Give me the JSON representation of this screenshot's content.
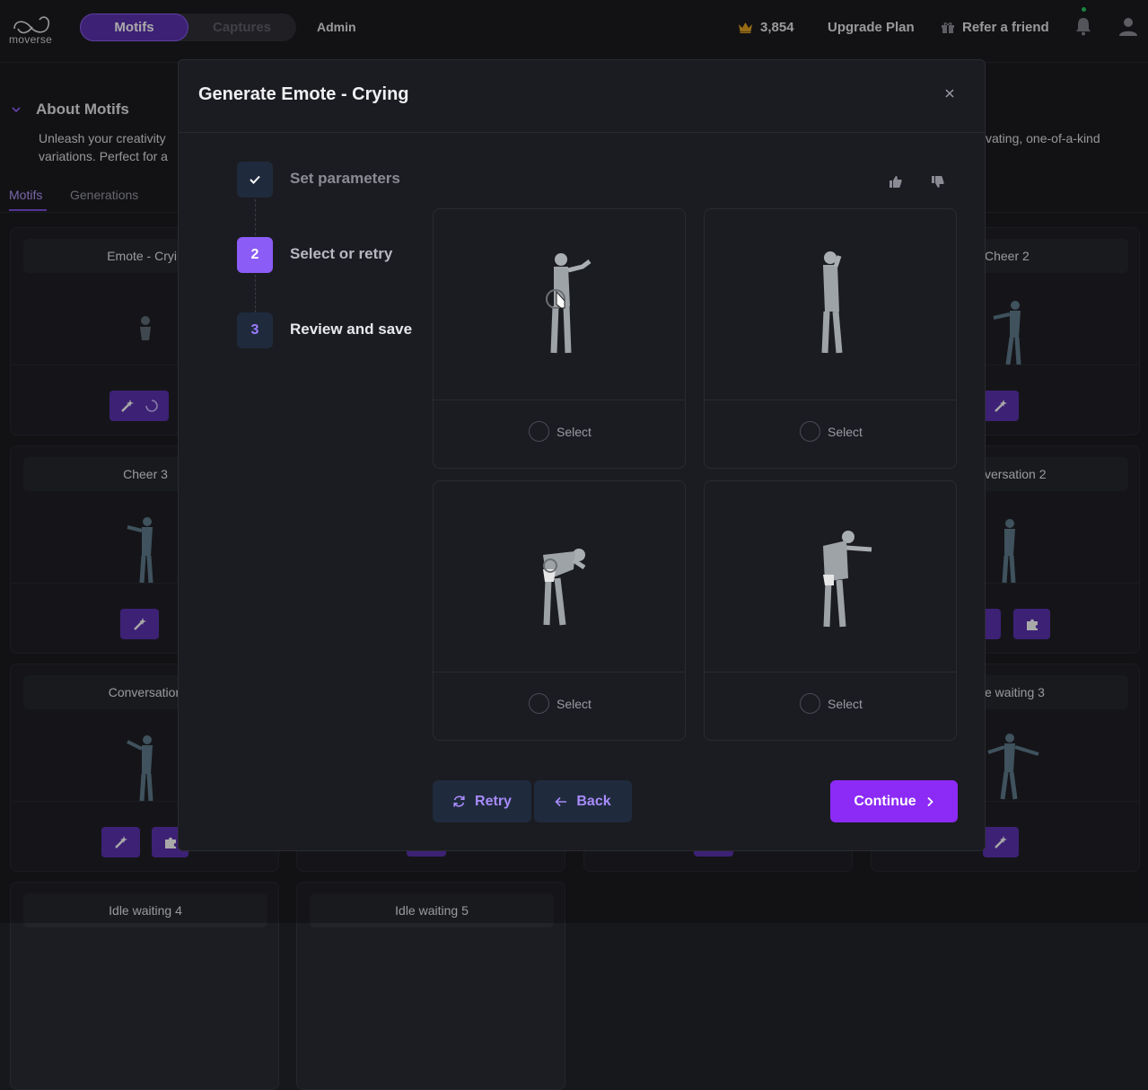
{
  "brand": {
    "name": "moverse"
  },
  "nav": {
    "segment": [
      {
        "label": "Motifs",
        "active": true
      },
      {
        "label": "Captures",
        "active": false
      }
    ],
    "admin": "Admin",
    "credits": "3,854",
    "upgrade": "Upgrade Plan",
    "refer": "Refer a friend"
  },
  "page": {
    "about_title": "About Motifs",
    "about_line1": "Unleash your creativity",
    "about_line2": "variations. Perfect for a",
    "about_line1_right": "vating, one-of-a-kind",
    "tabs": [
      "Motifs",
      "Generations"
    ],
    "cards": [
      {
        "title": "Emote - Cryin"
      },
      {
        "title": "Cheer 2"
      },
      {
        "title": "Cheer 3"
      },
      {
        "title": "versation 2"
      },
      {
        "title": "Conversation"
      },
      {
        "title": "e waiting 3"
      },
      {
        "title": "Idle waiting 4"
      },
      {
        "title": "Idle waiting 5"
      }
    ]
  },
  "modal": {
    "title": "Generate Emote - Crying",
    "steps": [
      {
        "number": "",
        "label": "Set parameters",
        "state": "done"
      },
      {
        "number": "2",
        "label": "Select or retry",
        "state": "current"
      },
      {
        "number": "3",
        "label": "Review and save",
        "state": "next"
      }
    ],
    "options": [
      {
        "select_label": "Select"
      },
      {
        "select_label": "Select"
      },
      {
        "select_label": "Select"
      },
      {
        "select_label": "Select"
      }
    ],
    "retry_label": "Retry",
    "back_label": "Back",
    "continue_label": "Continue"
  },
  "colors": {
    "accent": "#8b2bf5",
    "accent_dark": "#5a2fb0",
    "success": "#22c55e",
    "crown": "#e0a21b"
  }
}
